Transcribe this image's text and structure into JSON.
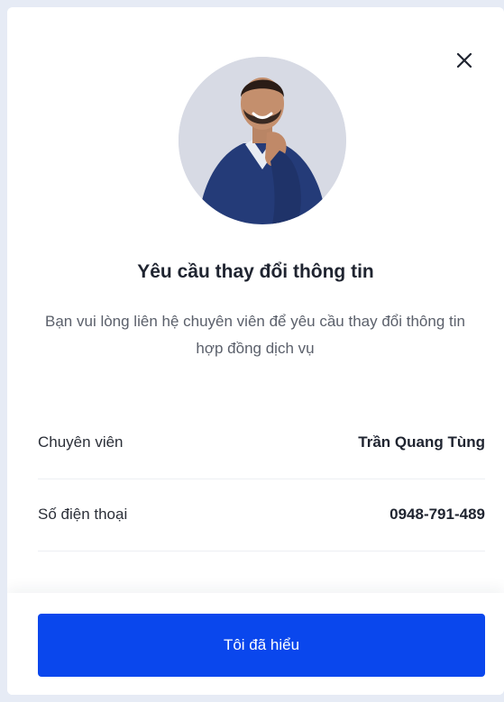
{
  "dialog": {
    "title": "Yêu cầu thay đổi thông tin",
    "description": "Bạn vui lòng liên hệ chuyên viên để yêu cầu thay đổi thông tin hợp đồng dịch vụ",
    "close_icon": "close-icon",
    "avatar_icon": "person-avatar"
  },
  "contact": {
    "rows": [
      {
        "label": "Chuyên viên",
        "value": "Trần Quang Tùng"
      },
      {
        "label": "Số điện thoại",
        "value": "0948-791-489"
      }
    ]
  },
  "footer": {
    "confirm_label": "Tôi đã hiểu"
  },
  "colors": {
    "primary": "#0a47ed",
    "title_text": "#1f2430",
    "body_text": "#5b606b",
    "page_bg": "#e6ebf5"
  }
}
